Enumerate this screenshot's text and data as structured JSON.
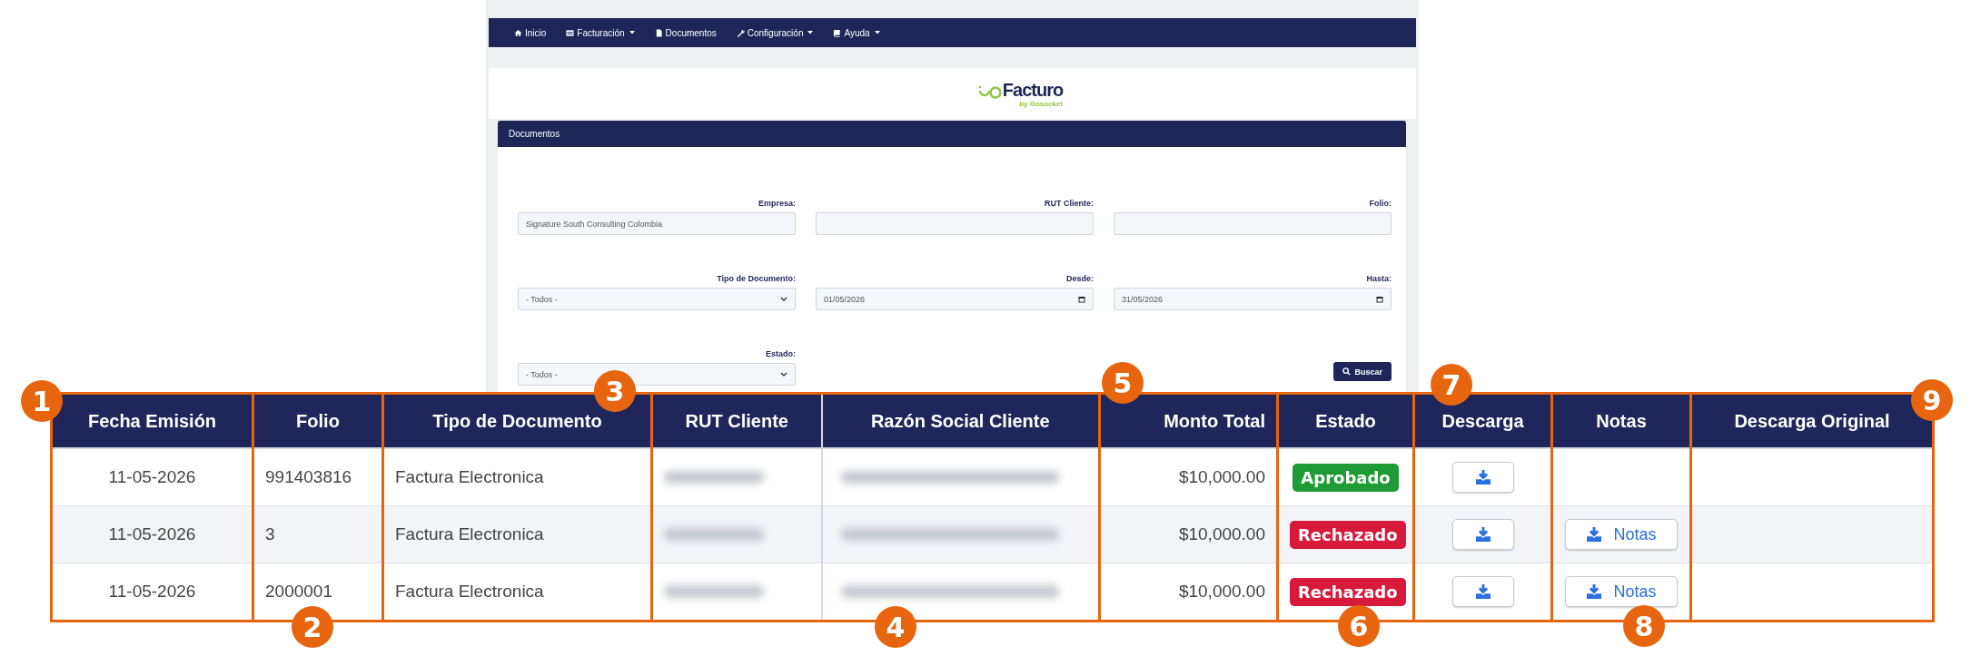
{
  "nav": [
    {
      "label": "Inicio",
      "dropdown": false
    },
    {
      "label": "Facturación",
      "dropdown": true
    },
    {
      "label": "Documentos",
      "dropdown": false
    },
    {
      "label": "Configuración",
      "dropdown": true
    },
    {
      "label": "Ayuda",
      "dropdown": true
    }
  ],
  "logo": {
    "name": "Facturo",
    "tagline": "by Gosocket"
  },
  "panel": {
    "title": "Documentos"
  },
  "filters": [
    {
      "label": "Empresa:",
      "kind": "text",
      "value": "Signature South Consulting Colombia"
    },
    {
      "label": "RUT Cliente:",
      "kind": "text"
    },
    {
      "label": "Folio:",
      "kind": "text"
    },
    {
      "label": "Tipo de Documento:",
      "kind": "select",
      "value": "- Todos -"
    },
    {
      "label": "Desde:",
      "kind": "date",
      "value": "01/05/2026"
    },
    {
      "label": "Hasta:",
      "kind": "date",
      "value": "31/05/2026"
    },
    {
      "label": "Estado:",
      "kind": "select",
      "value": "- Todos -"
    }
  ],
  "search_button": "Buscar",
  "table": {
    "columns": [
      "Fecha Emisión",
      "Folio",
      "Tipo de Documento",
      "RUT Cliente",
      "Razón Social Cliente",
      "Monto Total",
      "Estado",
      "Descarga",
      "Notas",
      "Descarga Original"
    ],
    "rows": [
      {
        "fecha": "11-05-2026",
        "folio": "991403816",
        "tipo": "Factura Electronica",
        "rut_blurred": true,
        "razon_blurred": true,
        "monto": "$10,000.00",
        "estado": {
          "label": "Aprobado",
          "color": "#1e9b35"
        },
        "notas": null
      },
      {
        "fecha": "11-05-2026",
        "folio": "3",
        "tipo": "Factura Electronica",
        "rut_blurred": true,
        "razon_blurred": true,
        "monto": "$10,000.00",
        "estado": {
          "label": "Rechazado",
          "color": "#d7193a"
        },
        "notas": "Notas"
      },
      {
        "fecha": "11-05-2026",
        "folio": "2000001",
        "tipo": "Factura Electronica",
        "rut_blurred": true,
        "razon_blurred": true,
        "monto": "$10,000.00",
        "estado": {
          "label": "Rechazado",
          "color": "#d7193a"
        },
        "notas": "Notas"
      }
    ]
  },
  "annotations": [
    "1",
    "2",
    "3",
    "4",
    "5",
    "6",
    "7",
    "8",
    "9"
  ]
}
